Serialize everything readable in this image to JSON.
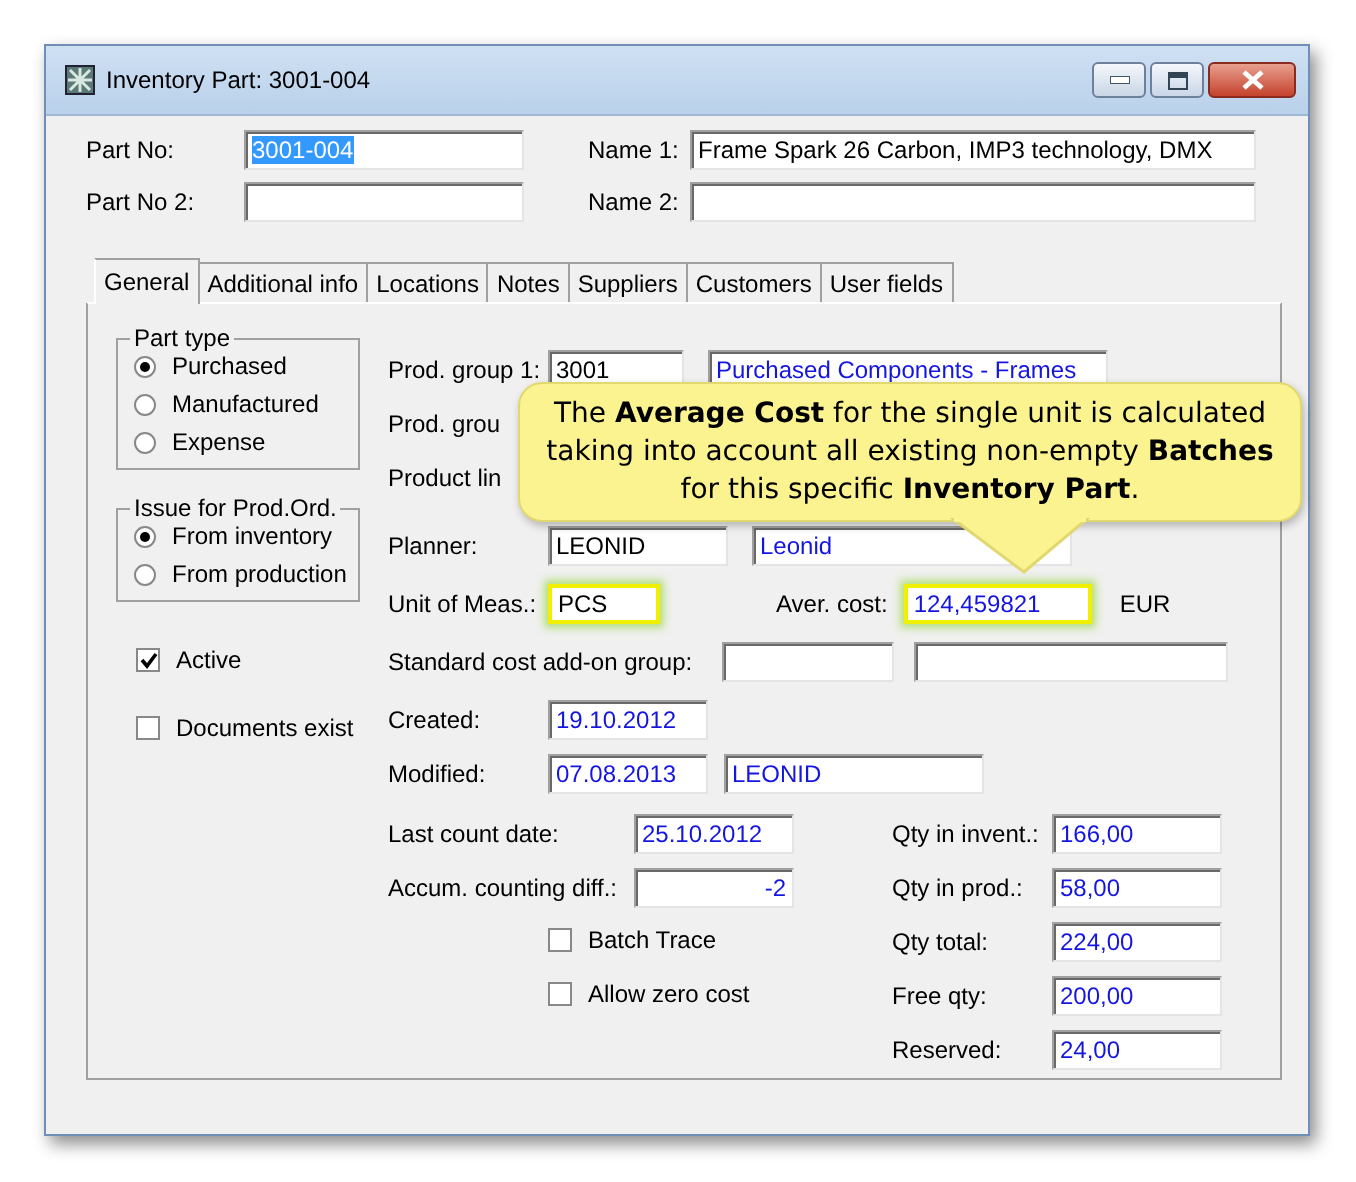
{
  "window": {
    "title": "Inventory Part: 3001-004"
  },
  "header_fields": [
    {
      "label": "Part No:",
      "value": "3001-004",
      "text_selected": true
    },
    {
      "label": "Name 1:",
      "value": "Frame Spark 26 Carbon, IMP3 technology, DMX",
      "text_selected": false
    },
    {
      "label": "Part No 2:"
    },
    {
      "label": "Name 2:"
    }
  ],
  "tabs": [
    {
      "label": "General",
      "selected": true
    },
    {
      "label": "Additional info",
      "selected": false
    },
    {
      "label": "Locations",
      "selected": false
    },
    {
      "label": "Notes",
      "selected": false
    },
    {
      "label": "Suppliers",
      "selected": false
    },
    {
      "label": "Customers",
      "selected": false
    },
    {
      "label": "User fields",
      "selected": false
    }
  ],
  "part_type": {
    "title": "Part type",
    "options": [
      {
        "label": "Purchased",
        "selected": true
      },
      {
        "label": "Manufactured",
        "selected": false
      },
      {
        "label": "Expense",
        "selected": false
      }
    ]
  },
  "issue_for_prod_ord": {
    "title": "Issue for Prod.Ord.",
    "options": [
      {
        "label": "From inventory",
        "selected": true
      },
      {
        "label": "From production",
        "selected": false
      }
    ]
  },
  "flags": [
    {
      "label": "Active",
      "checked": true
    },
    {
      "label": "Documents exist",
      "checked": false
    }
  ],
  "prod_group_1": {
    "label": "Prod. group 1:",
    "code": "3001",
    "name": "Purchased Components - Frames"
  },
  "prod_group_2": {
    "label": "Prod. grou"
  },
  "product_line": {
    "label": "Product lin"
  },
  "planner": {
    "label": "Planner:",
    "code": "LEONID",
    "name": "Leonid"
  },
  "unit_of_meas": {
    "label": "Unit of Meas.:",
    "value": "PCS",
    "highlighted": true
  },
  "aver_cost": {
    "label": "Aver. cost:",
    "value": "124,459821",
    "currency": "EUR",
    "highlighted": true
  },
  "standard_cost_addon_group": {
    "label": "Standard cost add-on group:"
  },
  "created": {
    "label": "Created:",
    "value": "19.10.2012"
  },
  "modified": {
    "label": "Modified:",
    "date": "07.08.2013",
    "user": "LEONID"
  },
  "last_count_date": {
    "label": "Last count date:",
    "value": "25.10.2012"
  },
  "accum_counting_diff": {
    "label": "Accum. counting diff.:",
    "value": "-2"
  },
  "options": [
    {
      "label": "Batch Trace",
      "checked": false
    },
    {
      "label": "Allow zero cost",
      "checked": false
    }
  ],
  "quantities": [
    {
      "label": "Qty in invent.:",
      "value": "166,00"
    },
    {
      "label": "Qty in prod.:",
      "value": "58,00"
    },
    {
      "label": "Qty total:",
      "value": "224,00"
    },
    {
      "label": "Free qty:",
      "value": "200,00"
    },
    {
      "label": "Reserved:",
      "value": "24,00"
    }
  ],
  "callout": {
    "text": "The **Average Cost** for the single unit is calculated taking into account all existing non-empty **Batches** for this specific **Inventory Part**."
  }
}
